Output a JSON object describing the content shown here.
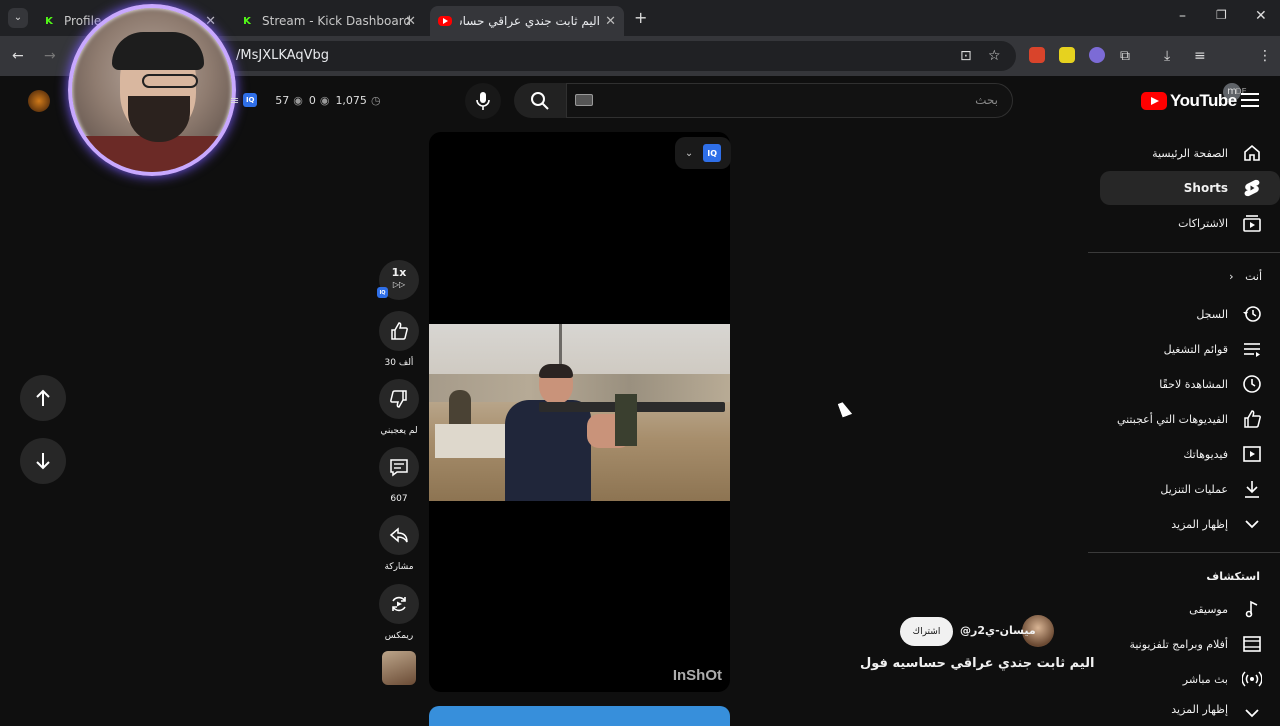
{
  "browser": {
    "tabs": [
      {
        "title": "Profile - Ki",
        "favicon": "kick-icon"
      },
      {
        "title": "Stream - Kick Dashboard",
        "favicon": "kick-icon"
      },
      {
        "title": "اليم ثابت جندي عراقي حساس",
        "favicon": "youtube-icon",
        "active": true
      }
    ],
    "url": "/MsJXLKAqVbg",
    "new_tab": "+"
  },
  "overlay": {
    "viewers": "57",
    "zero": "0",
    "count": "1,075"
  },
  "masthead": {
    "logo": "YouTube",
    "region": "DE",
    "search_placeholder": "بحث"
  },
  "sidebar": {
    "items_top": [
      {
        "label": "الصفحة الرئيسية",
        "icon": "home-icon"
      },
      {
        "label": "Shorts",
        "icon": "shorts-icon",
        "selected": true
      },
      {
        "label": "الاشتراكات",
        "icon": "subscriptions-icon"
      }
    ],
    "you_header": "أنت",
    "you_chevron": "›",
    "items_you": [
      {
        "label": "السجل",
        "icon": "history-icon"
      },
      {
        "label": "قوائم التشغيل",
        "icon": "playlists-icon"
      },
      {
        "label": "المشاهدة لاحقًا",
        "icon": "watch-later-icon"
      },
      {
        "label": "الفيديوهات التي أعجبتني",
        "icon": "liked-icon"
      },
      {
        "label": "فيديوهاتك",
        "icon": "your-videos-icon"
      },
      {
        "label": "عمليات التنزيل",
        "icon": "downloads-icon"
      },
      {
        "label": "إظهار المزيد",
        "icon": "chevron-down-icon"
      }
    ],
    "explore_header": "استكشاف",
    "items_explore": [
      {
        "label": "موسيقى",
        "icon": "music-icon"
      },
      {
        "label": "أفلام وبرامج تلفزيونية",
        "icon": "movies-icon"
      },
      {
        "label": "بث مباشر",
        "icon": "live-icon"
      },
      {
        "label": "إظهار المزيد",
        "icon": "chevron-down-icon"
      }
    ]
  },
  "player": {
    "speed": "1x",
    "watermark": "InShOt",
    "iq_badge": "IQ"
  },
  "actions": {
    "likes": "30 ألف",
    "dislike": "لم يعجبني",
    "comments": "607",
    "share": "مشاركة",
    "remix": "ريمكس"
  },
  "short": {
    "channel": "@ميسان-ي2ر",
    "subscribe": "اشتراك",
    "title": "اليم ثابت جندي عراقي حساسيه فول"
  },
  "colors": {
    "brand_red": "#ff0000",
    "kick_green": "#53fc18",
    "cam_ring": "#c8a8ff"
  }
}
